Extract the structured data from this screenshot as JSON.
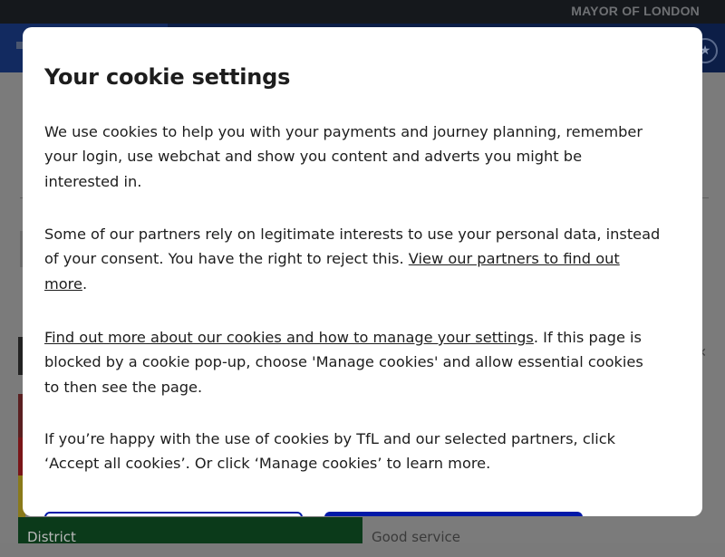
{
  "header": {
    "brand_text": "MAYOR OF LONDON"
  },
  "background": {
    "status_line": "District",
    "status_value": "Good service"
  },
  "cookie_modal": {
    "title": "Your cookie settings",
    "paragraph1": "We use cookies to help you with your payments and journey planning, remember your login, use webchat and show you content and adverts you might be interested in.",
    "paragraph2_text": "Some of our partners rely on legitimate interests to use your personal data, instead of your consent. You have the right to reject this. ",
    "paragraph2_link": "View our partners to find out more",
    "paragraph2_end": ".",
    "paragraph3_link": "Find out more about our cookies and how to manage your settings",
    "paragraph3_text": ". If this page is blocked by a cookie pop-up, choose 'Manage cookies' and allow essential cookies to then see the page.",
    "paragraph4": "If you’re happy with the use of cookies by TfL and our selected partners, click ‘Accept all cookies’. Or click ‘Manage cookies’ to learn more.",
    "manage_button": "",
    "accept_button": ""
  },
  "colors": {
    "accent_blue": "#0019a8",
    "overlay": "#7b7b7b",
    "district_green": "#0b3a1a"
  }
}
